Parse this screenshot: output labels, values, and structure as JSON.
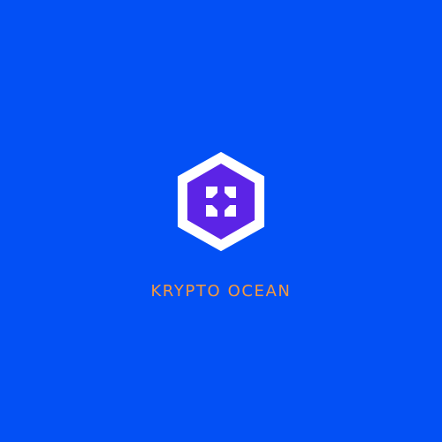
{
  "colors": {
    "background": "#0350F5",
    "hexagon_outer": "#FFFFFF",
    "hexagon_inner": "#5C24E6",
    "glyph": "#FFFFFF",
    "brand_text": "#F59A3E"
  },
  "logo": {
    "icon": "hexagon-emblem-icon",
    "glyph_icon": "four-petal-cross-icon"
  },
  "brand": {
    "name": "KRYPTO OCEAN"
  }
}
